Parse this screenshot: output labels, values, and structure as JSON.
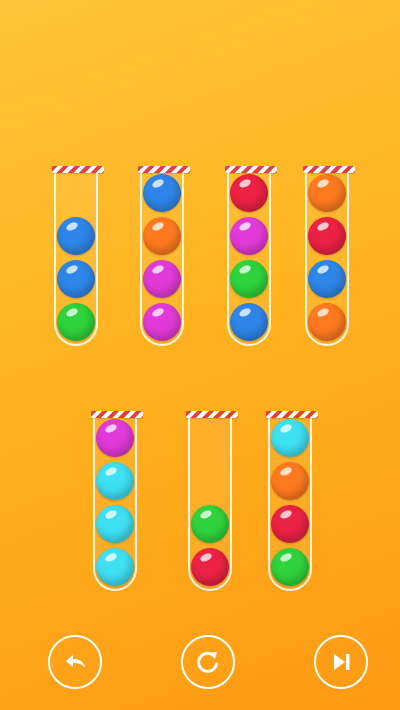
{
  "colors": {
    "blue": "#2f86e8",
    "green": "#2fd33c",
    "orange": "#ff7a1f",
    "magenta": "#e23ad8",
    "red": "#ec2244",
    "cyan": "#3fe0f3",
    "tube_outline": "#ffffff",
    "cap_red": "#e24040"
  },
  "tubes": [
    {
      "balls": [
        "green",
        "blue",
        "blue"
      ]
    },
    {
      "balls": [
        "magenta",
        "magenta",
        "orange",
        "blue"
      ]
    },
    {
      "balls": [
        "blue",
        "green",
        "magenta",
        "red"
      ]
    },
    {
      "balls": [
        "orange",
        "blue",
        "red",
        "orange"
      ]
    },
    {
      "balls": [
        "cyan",
        "cyan",
        "cyan",
        "magenta"
      ]
    },
    {
      "balls": [
        "red",
        "green"
      ]
    },
    {
      "balls": [
        "green",
        "red",
        "orange",
        "cyan"
      ]
    }
  ],
  "controls": {
    "undo_icon": "undo-arrow-icon",
    "restart_icon": "restart-circular-arrow-icon",
    "skip_icon": "skip-forward-icon"
  }
}
